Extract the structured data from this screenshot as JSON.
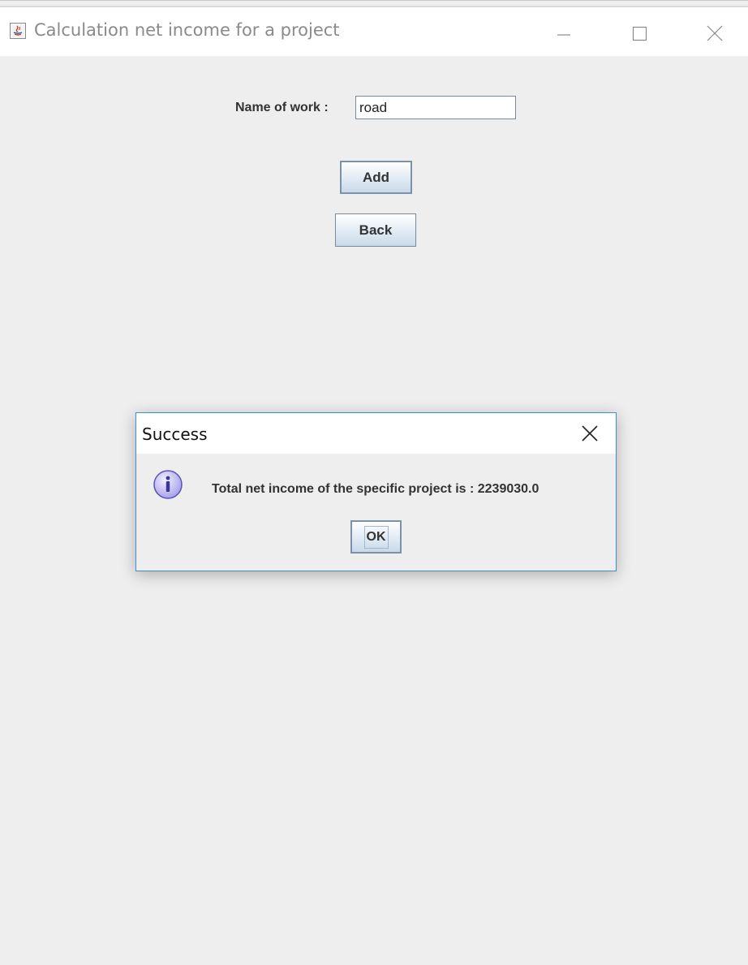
{
  "window": {
    "title": "Calculation net income for a project",
    "icons": {
      "app": "java-app-icon",
      "minimize": "minimize-icon",
      "maximize": "maximize-icon",
      "close": "close-icon"
    }
  },
  "form": {
    "name_label": "Name of work :",
    "name_value": "road",
    "add_label": "Add",
    "back_label": "Back"
  },
  "dialog": {
    "title": "Success",
    "message": "Total net income of the specific project is : 2239030.0",
    "ok_label": "OK",
    "icons": {
      "info": "info-icon",
      "close": "close-icon"
    }
  },
  "colors": {
    "window_background": "#eeeeee",
    "dialog_border": "#3c8fd8",
    "button_border": "#7a8a99"
  }
}
